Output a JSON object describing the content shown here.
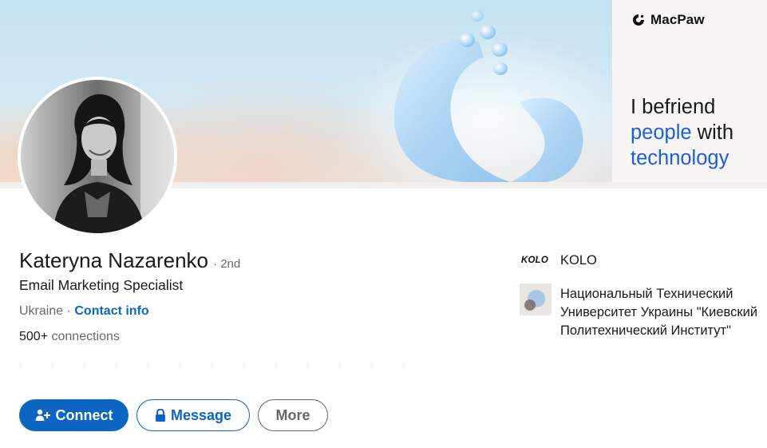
{
  "banner": {
    "brand": "MacPaw",
    "tagline_line1": "I befriend",
    "tagline_blue1": "people",
    "tagline_with": " with",
    "tagline_blue2": "technology",
    "accent": "#1c5fd9"
  },
  "profile": {
    "name": "Kateryna Nazarenko",
    "degree": "· 2nd",
    "headline": "Email Marketing Specialist",
    "location": "Ukraine",
    "separator": " · ",
    "contact_info": "Contact info",
    "connections_count": "500+",
    "connections_label": " connections"
  },
  "orgs": [
    {
      "logo_text": "KOLO",
      "name": "KOLO",
      "icon": "kolo-logo"
    },
    {
      "name": "Национальный Технический Университет Украины \"Киевский Политехнический Институт\"",
      "icon": "kpi-logo"
    }
  ],
  "actions": {
    "connect": "Connect",
    "message": "Message",
    "more": "More",
    "primary_color": "#0a66c2"
  }
}
